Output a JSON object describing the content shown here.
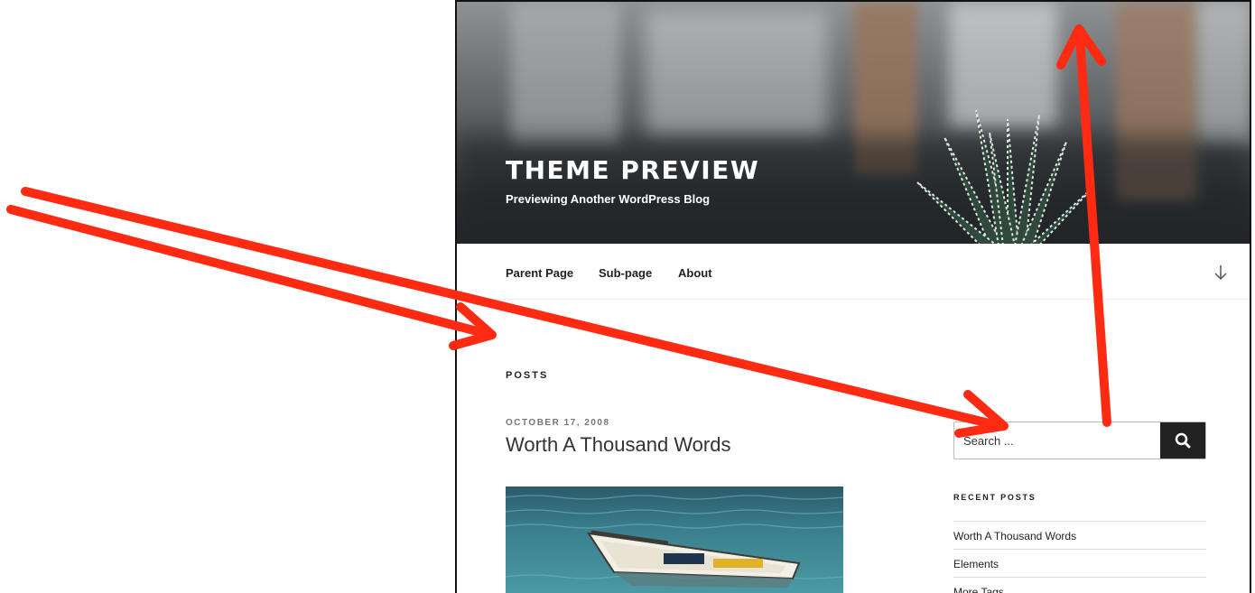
{
  "site": {
    "title": "THEME PREVIEW",
    "description": "Previewing Another WordPress Blog"
  },
  "nav": {
    "items": [
      {
        "label": "Parent Page"
      },
      {
        "label": "Sub-page"
      },
      {
        "label": "About"
      }
    ],
    "scroll_icon": "arrow-down-icon"
  },
  "content": {
    "heading": "POSTS",
    "post": {
      "date": "OCTOBER 17, 2008",
      "title": "Worth A Thousand Words"
    }
  },
  "sidebar": {
    "search": {
      "placeholder": "Search ...",
      "button_icon": "search-icon"
    },
    "recent_posts": {
      "title": "RECENT POSTS",
      "items": [
        {
          "label": "Worth A Thousand Words"
        },
        {
          "label": "Elements"
        },
        {
          "label": "More Tags"
        }
      ]
    }
  },
  "annotation": {
    "arrow_color": "#ff2a12"
  }
}
